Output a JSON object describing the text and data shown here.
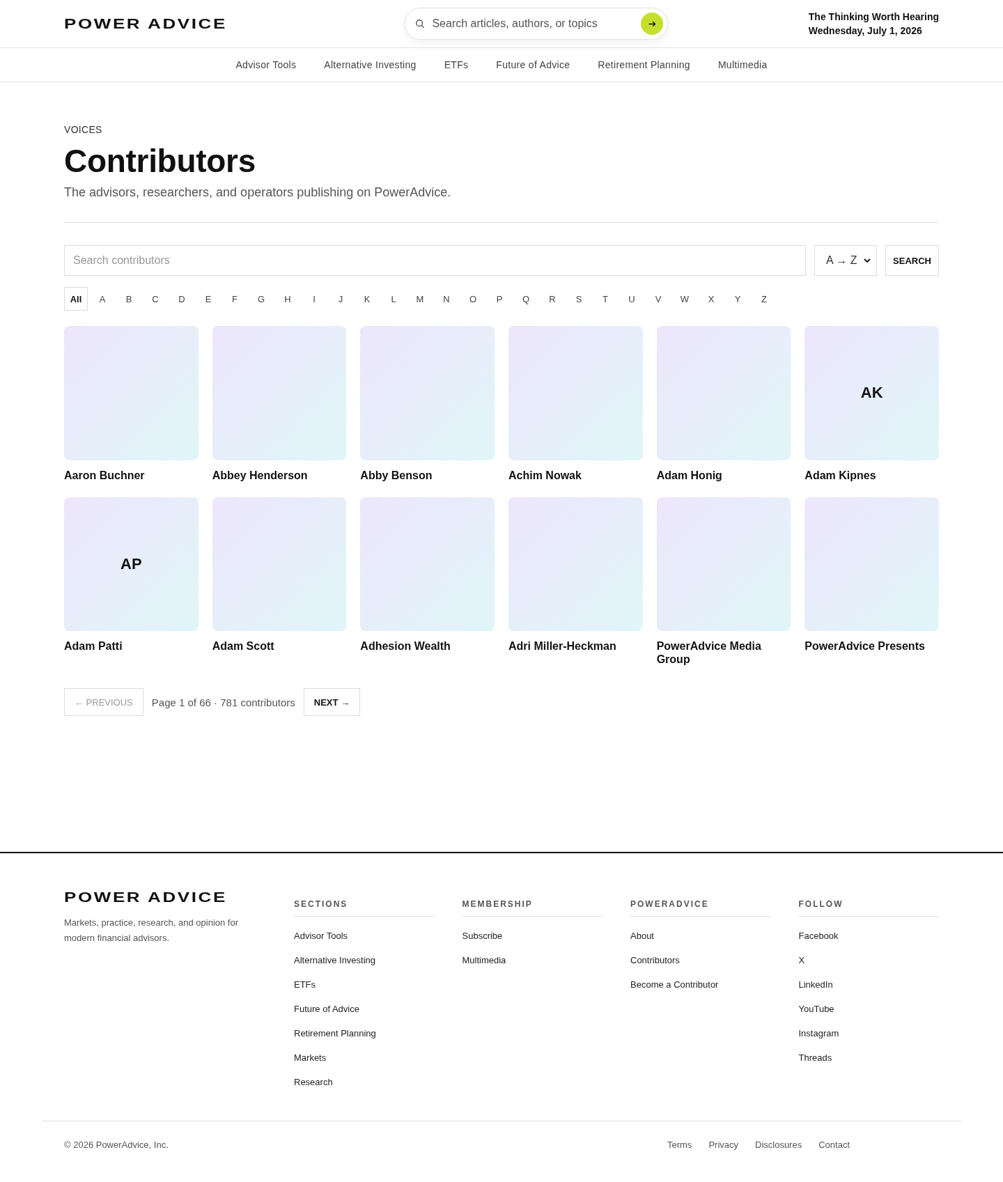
{
  "header": {
    "logo": "POWER ADVICE",
    "search": {
      "placeholder": "Search articles, authors, or topics"
    },
    "tagline": "The Thinking Worth Hearing",
    "date": "Wednesday, July 1, 2026"
  },
  "nav": [
    "Advisor Tools",
    "Alternative Investing",
    "ETFs",
    "Future of Advice",
    "Retirement Planning",
    "Multimedia"
  ],
  "hero": {
    "eyebrow": "VOICES",
    "title": "Contributors",
    "subtitle": "The advisors, researchers, and operators publishing on PowerAdvice."
  },
  "filters": {
    "search": {
      "placeholder": "Search contributors"
    },
    "sort": {
      "value": "A → Z"
    },
    "search_button": "SEARCH",
    "letters": [
      {
        "label": "All",
        "selected": true
      },
      {
        "label": "A",
        "selected": false
      },
      {
        "label": "B",
        "selected": false
      },
      {
        "label": "C",
        "selected": false
      },
      {
        "label": "D",
        "selected": false
      },
      {
        "label": "E",
        "selected": false
      },
      {
        "label": "F",
        "selected": false
      },
      {
        "label": "G",
        "selected": false
      },
      {
        "label": "H",
        "selected": false
      },
      {
        "label": "I",
        "selected": false
      },
      {
        "label": "J",
        "selected": false
      },
      {
        "label": "K",
        "selected": false
      },
      {
        "label": "L",
        "selected": false
      },
      {
        "label": "M",
        "selected": false
      },
      {
        "label": "N",
        "selected": false
      },
      {
        "label": "O",
        "selected": false
      },
      {
        "label": "P",
        "selected": false
      },
      {
        "label": "Q",
        "selected": false
      },
      {
        "label": "R",
        "selected": false
      },
      {
        "label": "S",
        "selected": false
      },
      {
        "label": "T",
        "selected": false
      },
      {
        "label": "U",
        "selected": false
      },
      {
        "label": "V",
        "selected": false
      },
      {
        "label": "W",
        "selected": false
      },
      {
        "label": "X",
        "selected": false
      },
      {
        "label": "Y",
        "selected": false
      },
      {
        "label": "Z",
        "selected": false
      }
    ]
  },
  "contributors": [
    {
      "name": "Aaron Buchner"
    },
    {
      "name": "Abbey Henderson"
    },
    {
      "name": "Abby Benson"
    },
    {
      "name": "Achim Nowak"
    },
    {
      "name": "Adam Honig"
    },
    {
      "name": "Adam Kipnes",
      "initials": "AK"
    },
    {
      "name": "Adam Patti",
      "initials": "AP"
    },
    {
      "name": "Adam Scott"
    },
    {
      "name": "Adhesion Wealth"
    },
    {
      "name": "Adri Miller-Heckman"
    },
    {
      "name": "PowerAdvice Media Group"
    },
    {
      "name": "PowerAdvice Presents"
    }
  ],
  "pagination": {
    "previous": {
      "label": "← PREVIOUS",
      "disabled": true
    },
    "info": "Page 1 of 66 · 781 contributors",
    "next": {
      "label": "NEXT →",
      "disabled": false
    }
  },
  "footer": {
    "logo": "POWER ADVICE",
    "blurb": "Markets, practice, research, and opinion for modern financial advisors.",
    "columns": [
      {
        "title": "SECTIONS",
        "links": [
          "Advisor Tools",
          "Alternative Investing",
          "ETFs",
          "Future of Advice",
          "Retirement Planning",
          "Markets",
          "Research"
        ]
      },
      {
        "title": "MEMBERSHIP",
        "links": [
          "Subscribe",
          "Multimedia"
        ]
      },
      {
        "title": "POWERADVICE",
        "links": [
          "About",
          "Contributors",
          "Become a Contributor"
        ]
      },
      {
        "title": "FOLLOW",
        "links": [
          "Facebook",
          "X",
          "LinkedIn",
          "YouTube",
          "Instagram",
          "Threads"
        ]
      }
    ],
    "copyright": "© 2026 PowerAdvice, Inc.",
    "legal": [
      "Terms",
      "Privacy",
      "Disclosures",
      "Contact"
    ]
  }
}
